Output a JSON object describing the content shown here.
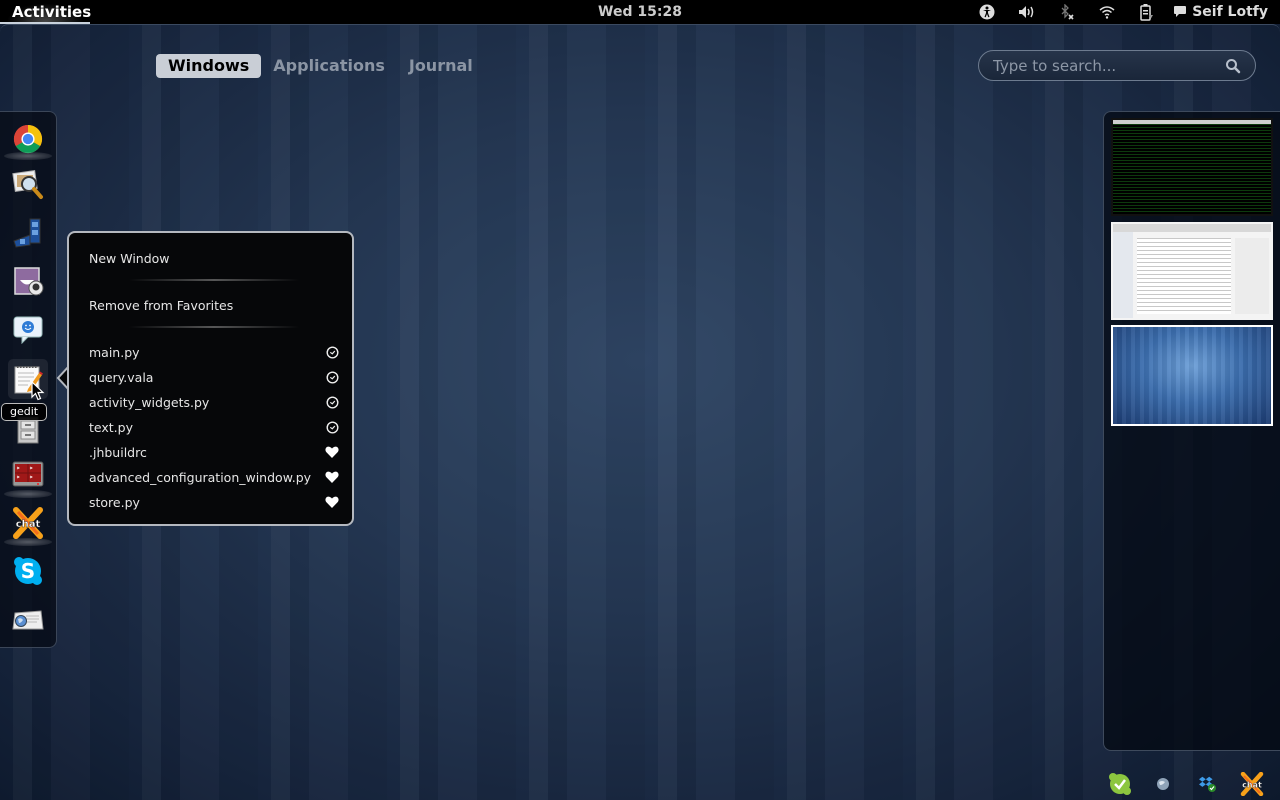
{
  "topbar": {
    "activities_label": "Activities",
    "clock": "Wed 15:28",
    "status_icons": [
      "accessibility-icon",
      "volume-icon",
      "bluetooth-disabled-icon",
      "wifi-icon",
      "battery-charging-icon"
    ],
    "user_name": "Seif Lotfy"
  },
  "view_selector": {
    "tabs": [
      {
        "label": "Windows",
        "active": true
      },
      {
        "label": "Applications",
        "active": false
      },
      {
        "label": "Journal",
        "active": false
      }
    ]
  },
  "search": {
    "placeholder": "Type to search...",
    "value": ""
  },
  "dash": {
    "items": [
      {
        "name": "Google Chrome",
        "icon": "chrome-icon",
        "running": true
      },
      {
        "name": "Image Viewer",
        "icon": "image-viewer-icon",
        "running": false
      },
      {
        "name": "Movie Player",
        "icon": "movie-player-icon",
        "running": false
      },
      {
        "name": "Cheese",
        "icon": "webcam-icon",
        "running": false
      },
      {
        "name": "Empathy",
        "icon": "chat-smiley-icon",
        "running": false
      },
      {
        "name": "gedit",
        "icon": "text-editor-icon",
        "running": false
      },
      {
        "name": "Files",
        "icon": "file-cabinet-icon",
        "running": false
      },
      {
        "name": "Terminal",
        "icon": "terminal-icon",
        "running": true
      },
      {
        "name": "XChat",
        "icon": "xchat-icon",
        "running": true
      },
      {
        "name": "Skype",
        "icon": "skype-icon",
        "running": false
      },
      {
        "name": "Web Browser",
        "icon": "web-browser-icon",
        "running": false
      }
    ],
    "tooltip": "gedit"
  },
  "app_menu": {
    "actions": [
      {
        "label": "New Window"
      },
      {
        "label": "Remove from Favorites"
      }
    ],
    "recent_files": [
      {
        "label": "main.py",
        "icon": "clock-icon"
      },
      {
        "label": "query.vala",
        "icon": "clock-icon"
      },
      {
        "label": "activity_widgets.py",
        "icon": "clock-icon"
      },
      {
        "label": "text.py",
        "icon": "clock-icon"
      }
    ],
    "favorite_files": [
      {
        "label": ".jhbuildrc",
        "icon": "heart-icon"
      },
      {
        "label": "advanced_configuration_window.py",
        "icon": "heart-icon"
      },
      {
        "label": "store.py",
        "icon": "heart-icon"
      }
    ]
  },
  "workspaces": [
    {
      "content": "terminal",
      "active": false
    },
    {
      "content": "browser",
      "active": false
    },
    {
      "content": "empty-desktop",
      "active": true
    }
  ],
  "message_tray": [
    {
      "icon": "skype-status-icon"
    },
    {
      "icon": "network-globe-icon"
    },
    {
      "icon": "dropbox-icon"
    },
    {
      "icon": "xchat-tray-icon"
    }
  ],
  "colors": {
    "topbar_bg": "#000000",
    "tab_active_bg": "#c9ced6",
    "menu_bg": "#060709",
    "menu_border": "#b4b8bf"
  }
}
